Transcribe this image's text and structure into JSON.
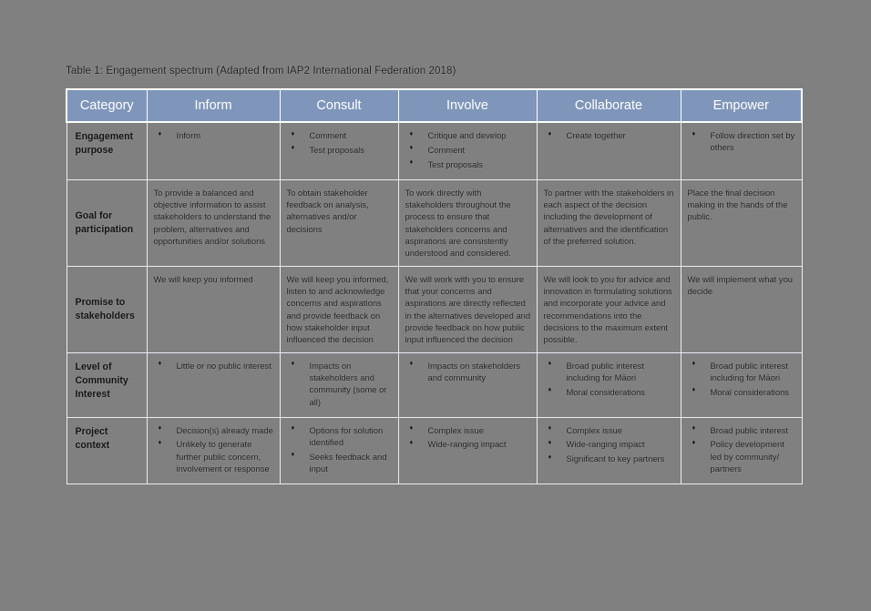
{
  "document": {
    "background_color": "#808080",
    "header_color": "#7f96ba",
    "caption": "Table 1: Engagement spectrum (Adapted from IAP2 International Federation 2018)"
  },
  "table": {
    "columns": [
      "Category",
      "Inform",
      "Consult",
      "Involve",
      "Collaborate",
      "Empower"
    ],
    "rows": [
      {
        "label": "Engagement purpose",
        "type": "bullets",
        "cells": [
          [
            "Inform"
          ],
          [
            "Comment",
            "Test proposals"
          ],
          [
            "Critique and develop",
            "Comment",
            "Test proposals"
          ],
          [
            "Create together"
          ],
          [
            "Follow direction set by others"
          ]
        ]
      },
      {
        "label": "Goal for participation",
        "type": "paragraph",
        "cells": [
          "To provide a balanced and objective information to assist stakeholders to understand the problem, alternatives and opportunities and/or solutions",
          "To obtain stakeholder feedback on analysis, alternatives and/or decisions",
          "To work directly with stakeholders throughout the process to ensure that stakeholders concerns and aspirations are consistently understood and considered.",
          "To partner with the stakeholders in each aspect of the decision including the development of alternatives and the identification of the preferred solution.",
          "Place the final decision making in the hands of the public."
        ]
      },
      {
        "label": "Promise to stakeholders",
        "type": "paragraph",
        "cells": [
          "We will keep you informed",
          "We will keep you informed, listen to and acknowledge concerns and aspirations and provide feedback on how stakeholder input influenced the decision",
          "We will work with you to ensure that your concerns and aspirations are directly reflected in the alternatives developed and provide feedback on how public input influenced the decision",
          "We will look to you for advice and innovation in formulating solutions and incorporate your advice and recommendations into the decisions to the maximum extent possible.",
          "We will implement what you decide"
        ]
      },
      {
        "label": "Level of Community Interest",
        "type": "bullets",
        "cells": [
          [
            "Little or no public interest"
          ],
          [
            "Impacts on stakeholders and community (some or all)"
          ],
          [
            "Impacts on stakeholders and community"
          ],
          [
            "Broad public interest including for Māori",
            "Moral considerations"
          ],
          [
            "Broad public interest including for Māori",
            "Moral considerations"
          ]
        ]
      },
      {
        "label": "Project context",
        "type": "bullets",
        "cells": [
          [
            "Decision(s) already made",
            "Unlikely to generate further public concern, involvement or response"
          ],
          [
            "Options for solution identified",
            "Seeks feedback and input"
          ],
          [
            "Complex issue",
            "Wide-ranging impact"
          ],
          [
            "Complex issue",
            "Wide-ranging impact",
            "Significant to key partners"
          ],
          [
            "Broad public interest",
            "Policy development led by community/ partners"
          ]
        ]
      }
    ]
  }
}
